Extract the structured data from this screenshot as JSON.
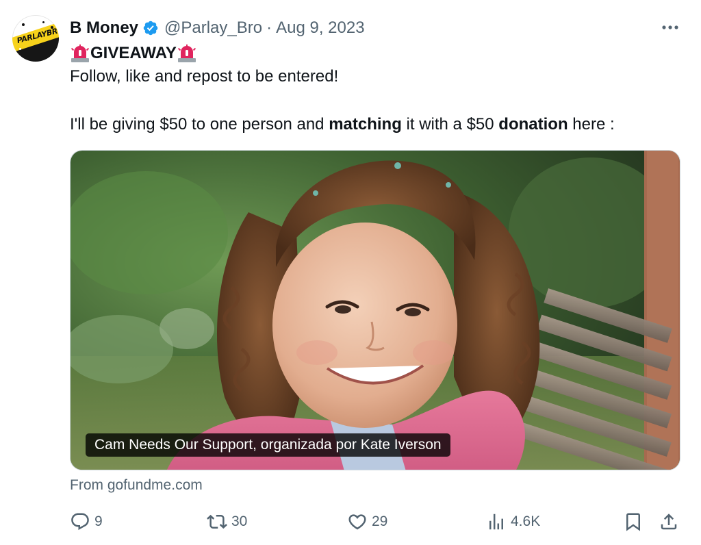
{
  "tweet": {
    "author_name": "B Money",
    "handle": "@Parlay_Bro",
    "separator": "·",
    "date": "Aug 9, 2023",
    "avatar_text": "PARLAYBRO",
    "heading": "GIVEAWAY",
    "line_follow": "Follow, like and repost to be entered!",
    "line_give_a": "I'll be giving $50 to one person and ",
    "line_give_b": "matching",
    "line_give_c": " it with a $50 ",
    "line_give_d": "donation",
    "line_give_e": " here :"
  },
  "card": {
    "caption": "Cam Needs Our Support, organizada por Kate Iverson",
    "source": "From gofundme.com"
  },
  "actions": {
    "replies": "9",
    "reposts": "30",
    "likes": "29",
    "views": "4.6K"
  },
  "colors": {
    "verified": "#1d9bf0",
    "muted": "#536471",
    "text": "#0f1419",
    "siren": "#e0245e"
  },
  "icons": [
    "verified-badge-icon",
    "more-icon",
    "siren-icon",
    "reply-icon",
    "repost-icon",
    "like-icon",
    "views-icon",
    "bookmark-icon",
    "share-icon"
  ]
}
